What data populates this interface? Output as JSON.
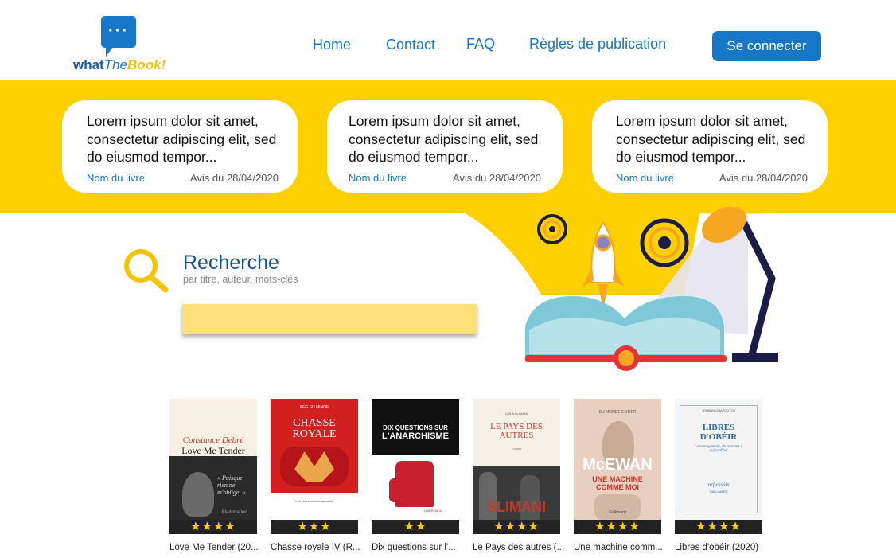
{
  "logo": {
    "what": "what",
    "the": "The",
    "book": "Book!"
  },
  "nav": {
    "home": "Home",
    "contact": "Contact",
    "faq": "FAQ",
    "rules": "Règles de publication",
    "login": "Se connecter"
  },
  "reviews": [
    {
      "text": "Lorem ipsum dolor sit amet, consectetur adipiscing elit, sed do eiusmod tempor...",
      "book": "Nom du livre",
      "date": "Avis du 28/04/2020"
    },
    {
      "text": "Lorem ipsum dolor sit amet, consectetur adipiscing elit, sed do eiusmod tempor...",
      "book": "Nom du livre",
      "date": "Avis du 28/04/2020"
    },
    {
      "text": "Lorem ipsum dolor sit amet, consectetur adipiscing elit, sed do eiusmod tempor...",
      "book": "Nom du livre",
      "date": "Avis du 28/04/2020"
    }
  ],
  "search": {
    "title": "Recherche",
    "subtitle": "par titre, auteur, mots-clés",
    "value": ""
  },
  "books": [
    {
      "title": "Love Me Tender (20...",
      "stars": "★★★★",
      "rating": 4,
      "cover_author": "Constance Debré",
      "cover_title": "Love Me Tender",
      "cover_quote": "« Puisque rien ne m'oblige. »",
      "cover_publisher": "Flammarion"
    },
    {
      "title": "Chasse royale IV (R...",
      "stars": "★★★",
      "rating": 3,
      "cover_author": "KEG SU MINOE",
      "cover_title": "CHASSE ROYALE",
      "cover_publisher": "Les Humanoïdes Associés"
    },
    {
      "title": "Dix questions sur l'...",
      "stars": "★★",
      "rating": 2,
      "cover_title_top": "DIX QUESTIONS SUR",
      "cover_title": "L'ANARCHISME",
      "cover_publisher": "LIBERTALIA"
    },
    {
      "title": "Le Pays des autres (...",
      "stars": "★★★★",
      "rating": 4,
      "cover_author": "LEÏLA SLIMANI",
      "cover_title": "LE PAYS DES AUTRES",
      "cover_genre": "roman",
      "cover_name": "SLIMANI"
    },
    {
      "title": "Une machine comm...",
      "stars": "★★★★",
      "rating": 4,
      "cover_series": "DU MONDE ENTIER",
      "cover_author": "McEWAN",
      "cover_title": "UNE MACHINE COMME MOI",
      "cover_publisher": "Gallimard"
    },
    {
      "title": "Libres d'obéir (2020)",
      "stars": "★★★★",
      "rating": 4,
      "cover_author": "JOHANN CHAPOUTOT",
      "cover_title": "LIBRES D'OBÉIR",
      "cover_sub": "Le management, du nazisme à aujourd'hui",
      "cover_collection": "nrf essais",
      "cover_publisher": "GALLIMARD"
    }
  ],
  "colors": {
    "brand_blue": "#1676c7",
    "band_yellow": "#ffd000",
    "search_yellow": "#ffe07a"
  }
}
